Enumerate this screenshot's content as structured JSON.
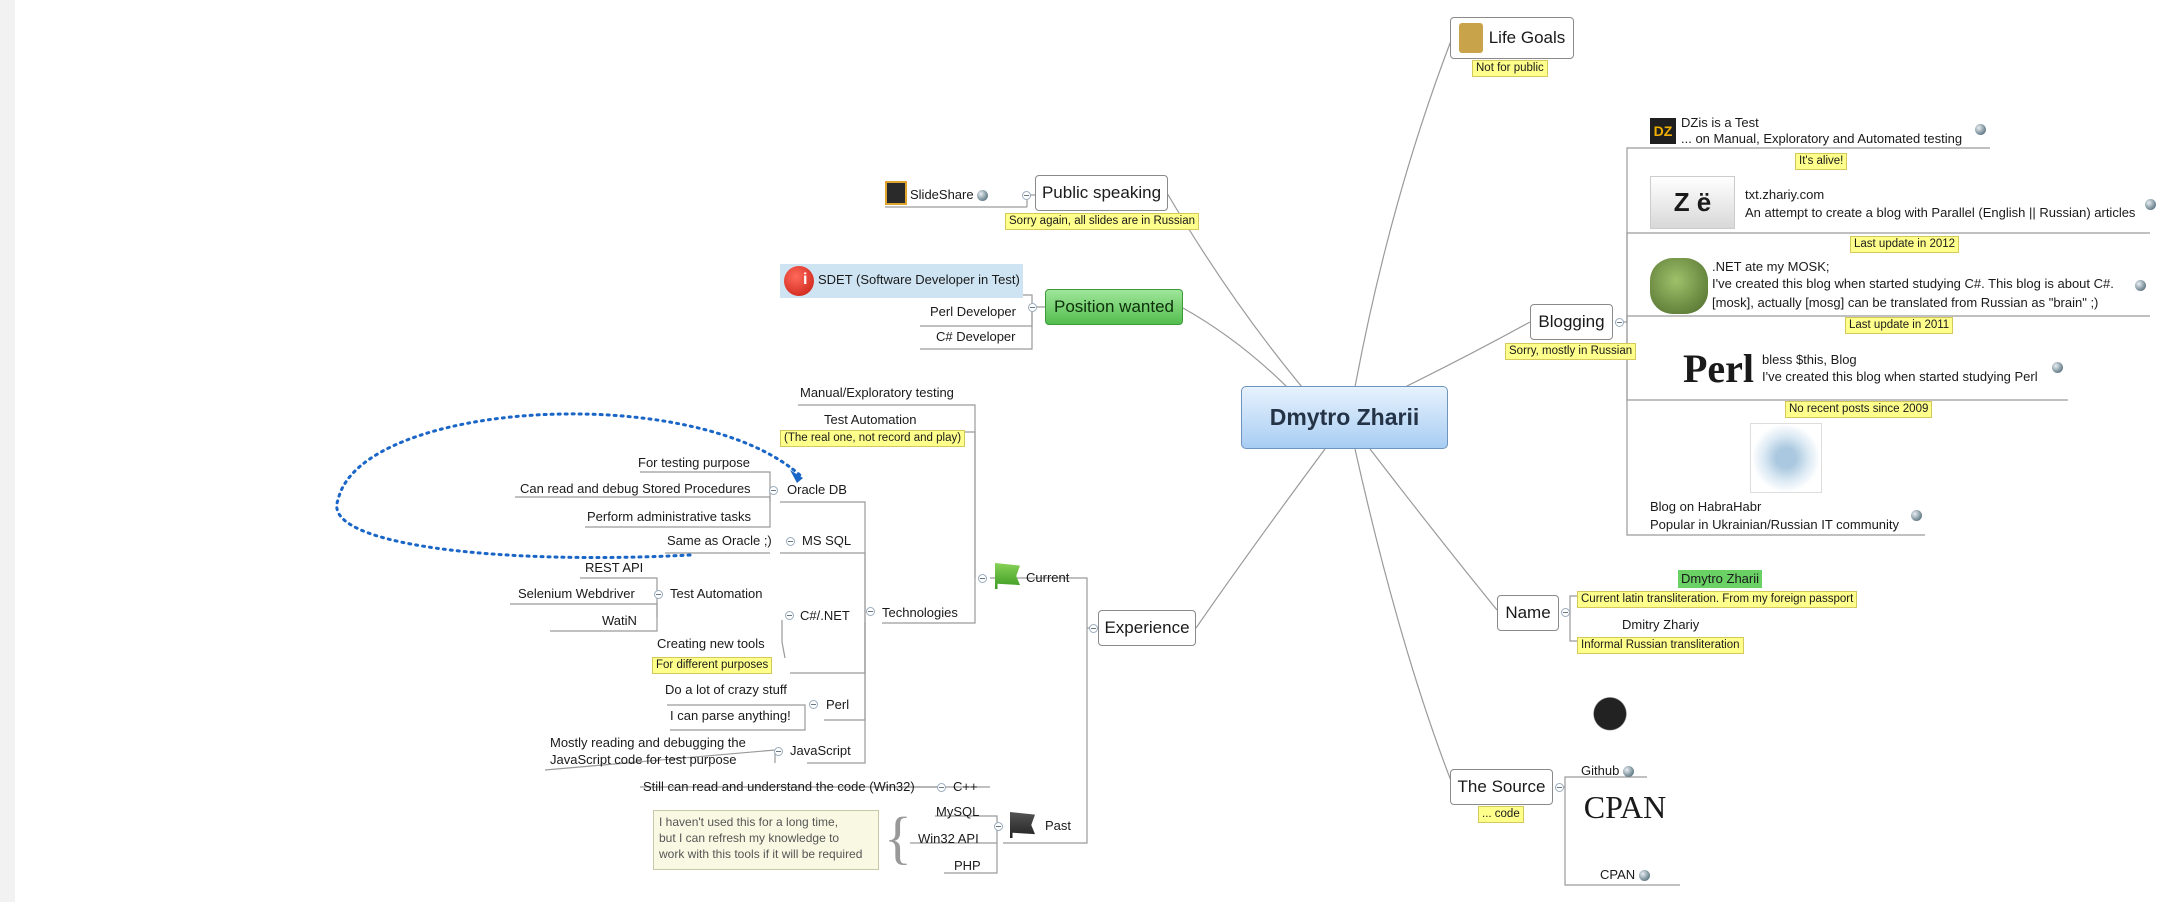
{
  "central": "Dmytro Zharii",
  "life_goals": {
    "label": "Life Goals",
    "note": "Not for public"
  },
  "public_speaking": {
    "label": "Public speaking",
    "note": "Sorry again, all slides are  in Russian",
    "slideshare": "SlideShare"
  },
  "position_wanted": {
    "label": "Position wanted",
    "sdet": "SDET (Software Developer in Test)",
    "perl": "Perl Developer",
    "csharp": "C# Developer"
  },
  "experience": {
    "label": "Experience",
    "current": "Current",
    "past": "Past",
    "manual": "Manual/Exploratory testing",
    "test_automation": "Test Automation",
    "test_automation_note": "(The real one, not record and play)",
    "technologies": "Technologies",
    "oracle": "Oracle  DB",
    "for_testing": "For testing purpose",
    "stored_proc": "Can read and debug Stored Procedures",
    "admin_tasks": "Perform administrative tasks",
    "mssql": "MS SQL",
    "same_as_oracle": "Same as Oracle ;)",
    "csnet": "C#/.NET",
    "rest_api": "REST API",
    "ta2": "Test Automation",
    "selenium": "Selenium Webdriver",
    "watin": "WatiN",
    "creating_tools": "Creating new tools",
    "diff_purposes": "For different purposes",
    "perl": "Perl",
    "crazy": "Do a lot of crazy stuff",
    "parse": "I can parse anything!",
    "js": "JavaScript",
    "js_desc1": "Mostly reading and debugging the",
    "js_desc2": "JavaScript code for test purpose",
    "cpp": "C++",
    "cpp_desc": "Still can read and understand the code (Win32)",
    "mysql": "MySQL",
    "win32": "Win32 API",
    "php": "PHP",
    "comment1": "I haven't used this for a long time,",
    "comment2": "but I can refresh my knowledge to",
    "comment3": "work with this tools if it will be required"
  },
  "blogging": {
    "label": "Blogging",
    "note": "Sorry, mostly in Russian",
    "dzis_title": "DZis is a Test",
    "dzis_sub": "... on Manual, Exploratory and Automated testing",
    "dzis_note": "It's alive!",
    "txt_title": "txt.zhariy.com",
    "txt_sub": "An attempt to create a blog with Parallel (English || Russian) articles",
    "txt_note": "Last update in 2012",
    "net_title": ".NET ate my MOSK;",
    "net_sub1": "I've created this blog when started studying C#. This blog is about C#.",
    "net_sub2": "[mosk], actually [mosg] can be translated from Russian as \"brain\" ;)",
    "net_note": "Last update in 2011",
    "perl_title": "bless $this, Blog",
    "perl_sub": "I've created this blog when started studying Perl",
    "perl_note": "No recent posts since 2009",
    "perl_logo": "Perl",
    "habr_title": "Blog on HabraHabr",
    "habr_sub": "Popular in Ukrainian/Russian IT community",
    "dz_logo": "DZ"
  },
  "name": {
    "label": "Name",
    "current_name": "Dmytro Zharii",
    "current_note": "Current  latin transliteration. From my foreign passport",
    "informal_name": "Dmitry Zhariy",
    "informal_note": "Informal Russian transliteration"
  },
  "source": {
    "label": "The Source",
    "note": "... code",
    "github": "Github",
    "cpan": "CPAN",
    "cpan_logo": "CPAN"
  },
  "colors": {
    "note_yellow": "#ffff8c",
    "green": "#53bd4e",
    "central_blue": "#a8cdf3",
    "relationship": "#1a66c7"
  }
}
